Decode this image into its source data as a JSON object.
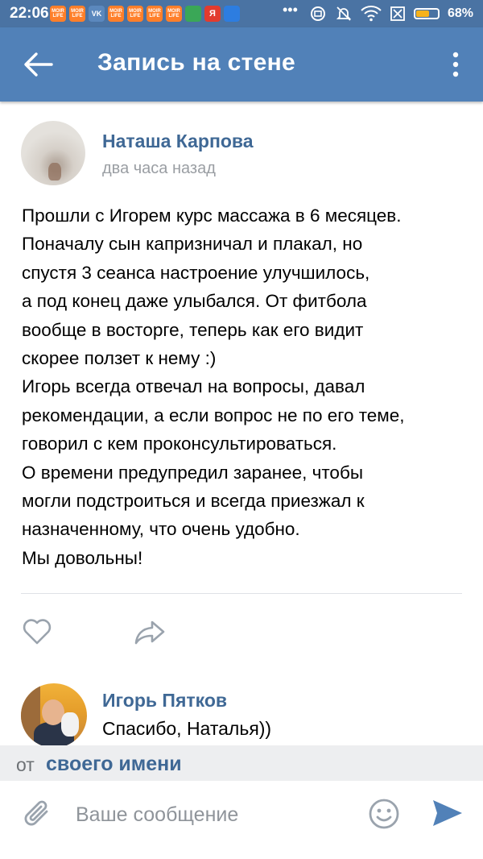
{
  "status_bar": {
    "time": "22:06",
    "app_icons": [
      {
        "label": "MOIR LIFE",
        "kind": "orange"
      },
      {
        "label": "MOIR LIFE",
        "kind": "orange"
      },
      {
        "label": "VK",
        "kind": "vk"
      },
      {
        "label": "MOIR LIFE",
        "kind": "orange"
      },
      {
        "label": "MOIR LIFE",
        "kind": "orange"
      },
      {
        "label": "MOIR LIFE",
        "kind": "orange"
      },
      {
        "label": "MOIR LIFE",
        "kind": "orange"
      },
      {
        "label": "",
        "kind": "green"
      },
      {
        "label": "Я",
        "kind": "yred"
      },
      {
        "label": "",
        "kind": "blue"
      }
    ],
    "overflow": "•••",
    "battery_level": 0.68,
    "battery_percent": "68%"
  },
  "header": {
    "title": "Запись на стене"
  },
  "post": {
    "author_name": "Наташа Карпова",
    "time": "два часа назад",
    "text": "Прошли с Игорем курс массажа в 6 месяцев.\nПоначалу сын капризничал и плакал, но\nспустя 3 сеанса настроение улучшилось,\nа под конец даже улыбался. От фитбола\nвообще в восторге, теперь как его видит\nскорее ползет к нему :)\nИгорь всегда отвечал на вопросы, давал\nрекомендации, а если вопрос не по его теме,\nговорил с кем проконсультироваться.\nО времени предупредил заранее, чтобы\nмогли подстроиться и всегда приезжал к\nназначенному, что очень удобно.\nМы довольны!"
  },
  "comment": {
    "author_name": "Игорь Пятков",
    "text": "Спасибо, Наталья))"
  },
  "from_bar": {
    "prefix": "от",
    "link": "своего имени"
  },
  "composer": {
    "placeholder": "Ваше сообщение",
    "value": ""
  },
  "colors": {
    "header_bg": "#5181b8",
    "status_bg": "#4a73a3",
    "link": "#3f6895",
    "meta": "#9a9ea3",
    "send": "#5181b8"
  }
}
